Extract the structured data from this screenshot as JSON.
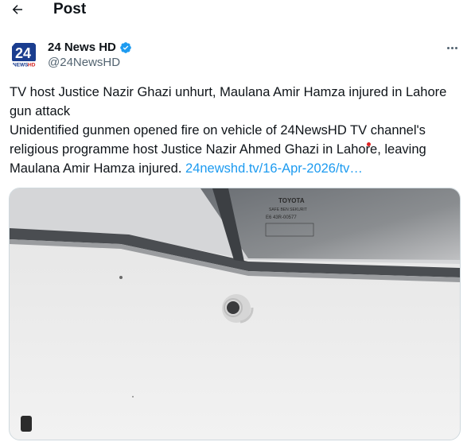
{
  "header": {
    "title": "Post",
    "back_icon": "arrow-left-icon"
  },
  "author": {
    "name": "24 News HD",
    "handle": "@24NewsHD",
    "verified": true,
    "avatar_logo_text": "24 NEWS HD"
  },
  "tweet": {
    "headline": "TV host Justice Nazir Ghazi unhurt, Maulana Amir Hamza injured in Lahore gun attack",
    "body": "Unidentified gunmen opened fire on vehicle of 24NewsHD TV channel's religious programme host Justice Nazir Ahmed Ghazi in Lahore, leaving Maulana Amir Hamza injured.",
    "link_text": "24newshd.tv/16-Apr-2026/tv…"
  },
  "media": {
    "description_icon": "video-media",
    "window_sticker_lines": [
      "TOYOTA",
      "SAFE BEN SEKURIT",
      "E6",
      "43R-00577"
    ]
  },
  "colors": {
    "accent": "#1d9bf0",
    "text": "#0f1419",
    "secondary": "#536471"
  }
}
